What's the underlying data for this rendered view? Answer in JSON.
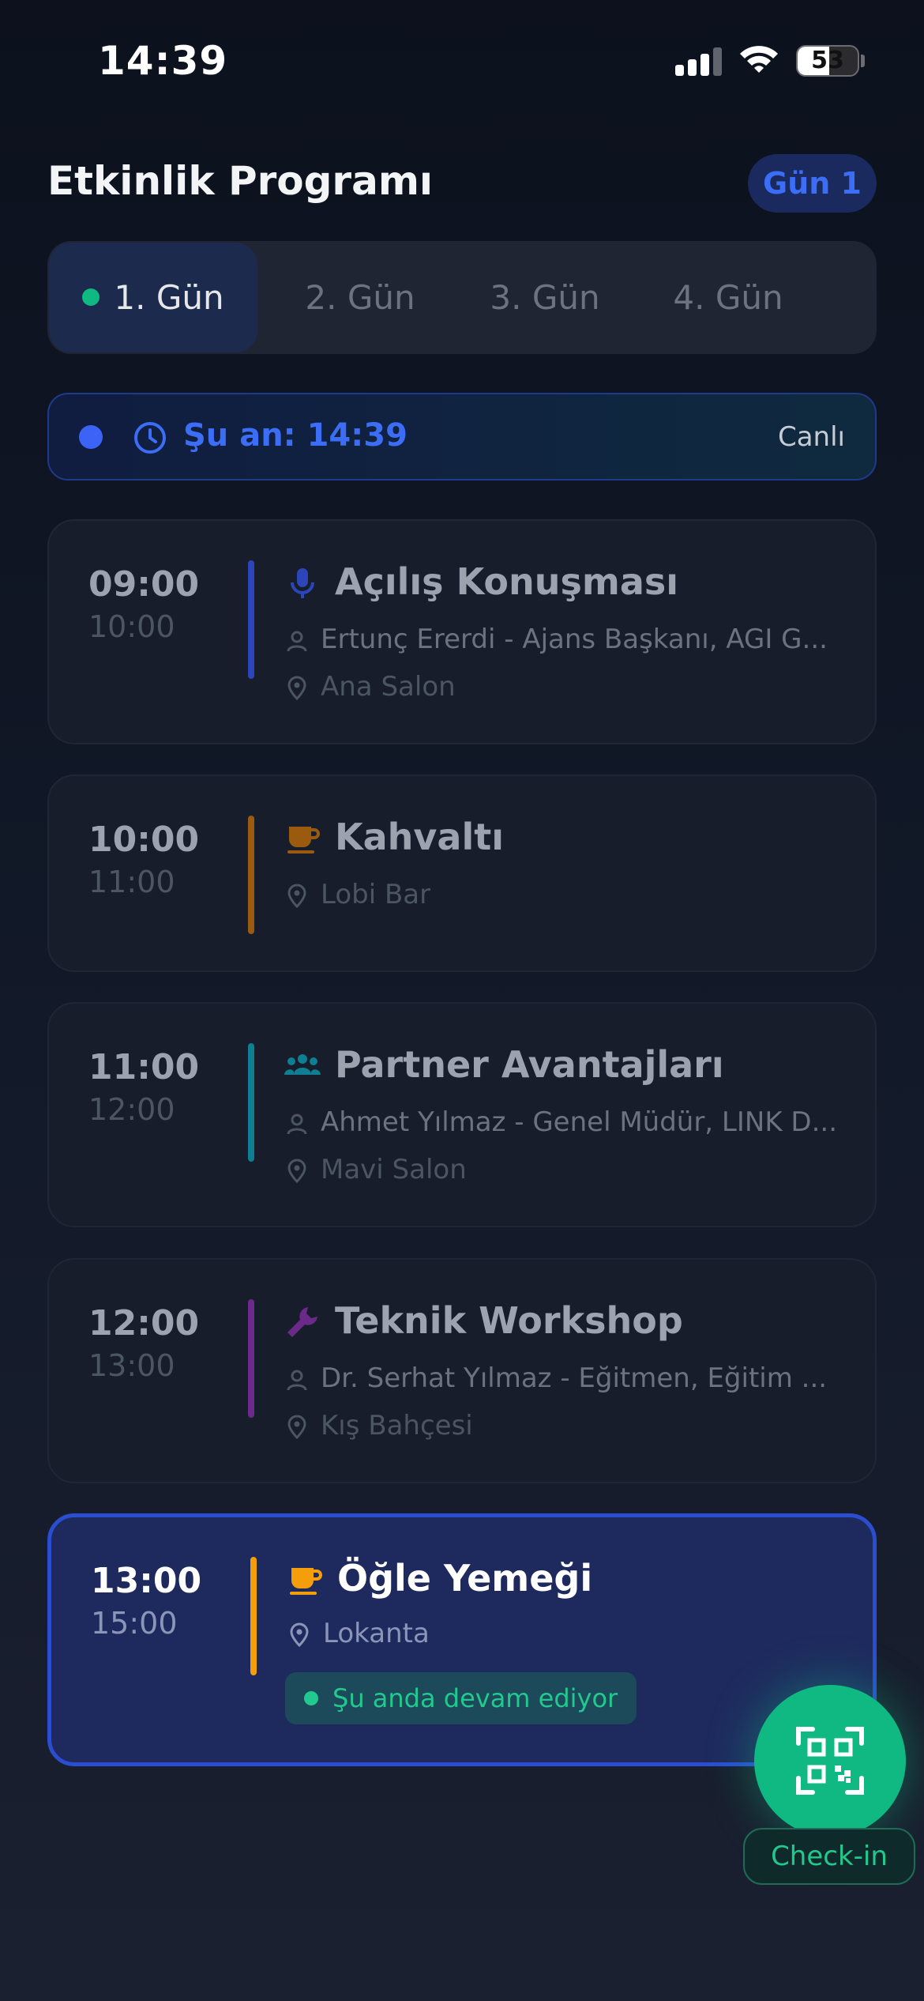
{
  "status_bar": {
    "time": "14:39",
    "battery": "53",
    "battery_level": 0.53
  },
  "header": {
    "title": "Etkinlik Programı",
    "day_badge": "Gün 1"
  },
  "tabs": [
    {
      "label": "1. Gün",
      "active": true
    },
    {
      "label": "2. Gün",
      "active": false
    },
    {
      "label": "3. Gün",
      "active": false
    },
    {
      "label": "4. Gün",
      "active": false
    }
  ],
  "now": {
    "text": "Şu an: 14:39",
    "live_label": "Canlı"
  },
  "sessions": [
    {
      "start": "09:00",
      "end": "10:00",
      "icon": "microphone-icon",
      "color": "#2c45b8",
      "title": "Açılış Konuşması",
      "speaker": "Ertunç Ererdi - Ajans Başkanı, AGI G...",
      "location": "Ana Salon",
      "current": false
    },
    {
      "start": "10:00",
      "end": "11:00",
      "icon": "coffee-cup-icon",
      "color": "#9a5a10",
      "title": "Kahvaltı",
      "speaker": "",
      "location": "Lobi Bar",
      "current": false
    },
    {
      "start": "11:00",
      "end": "12:00",
      "icon": "people-group-icon",
      "color": "#0e7f92",
      "title": "Partner Avantajları",
      "speaker": "Ahmet Yılmaz - Genel Müdür, LINK D...",
      "location": "Mavi Salon",
      "current": false
    },
    {
      "start": "12:00",
      "end": "13:00",
      "icon": "wrench-icon",
      "color": "#6b2a8a",
      "title": "Teknik Workshop",
      "speaker": "Dr. Serhat Yılmaz - Eğitmen, Eğitim ...",
      "location": "Kış Bahçesi",
      "current": false
    },
    {
      "start": "13:00",
      "end": "15:00",
      "icon": "coffee-cup-icon",
      "color": "#f59e0b",
      "title": "Öğle Yemeği",
      "speaker": "",
      "location": "Lokanta",
      "current": true,
      "status": "Şu anda devam ediyor"
    }
  ],
  "fab": {
    "label": "Check-in",
    "icon": "qr-code-icon"
  }
}
